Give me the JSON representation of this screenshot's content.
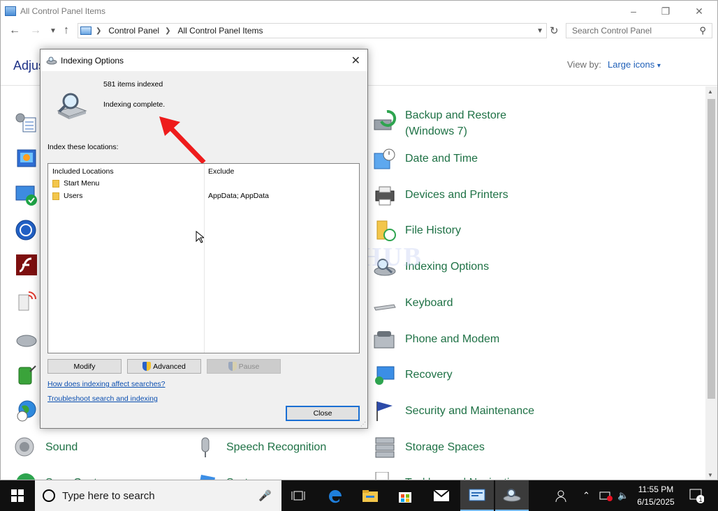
{
  "window": {
    "title": "All Control Panel Items",
    "breadcrumbs": [
      "Control Panel",
      "All Control Panel Items"
    ],
    "search_placeholder": "Search Control Panel",
    "heading": "Adjus",
    "view_by_label": "View by:",
    "view_by_value": "Large icons",
    "view_by_caret": "▾"
  },
  "left_items": [
    {
      "label": "",
      "icon": "admin-tools-icon"
    },
    {
      "label": "",
      "icon": "autoplay-icon"
    },
    {
      "label": "",
      "icon": "security-center-icon"
    },
    {
      "label": "",
      "icon": "ease-of-access-icon"
    },
    {
      "label": "",
      "icon": "flash-icon"
    },
    {
      "label": "",
      "icon": "internet-options-icon"
    },
    {
      "label": "",
      "icon": "mouse-icon"
    },
    {
      "label": "",
      "icon": "power-options-icon"
    },
    {
      "label": "",
      "icon": "region-icon"
    },
    {
      "label": "Sound",
      "icon": "speaker-icon"
    },
    {
      "label": "Sync Cent",
      "icon": "sync-center-icon"
    }
  ],
  "middle_items": [
    {
      "label": "Speech Recognition",
      "icon": "microphone-icon"
    },
    {
      "label": "System",
      "icon": "system-icon"
    }
  ],
  "right_items": [
    {
      "label": "Backup and Restore (Windows 7)",
      "icon": "backup-restore-icon"
    },
    {
      "label": "Date and Time",
      "icon": "date-time-icon"
    },
    {
      "label": "Devices and Printers",
      "icon": "devices-printers-icon"
    },
    {
      "label": "File History",
      "icon": "file-history-icon"
    },
    {
      "label": "Indexing Options",
      "icon": "indexing-options-icon"
    },
    {
      "label": "Keyboard",
      "icon": "keyboard-icon"
    },
    {
      "label": "Phone and Modem",
      "icon": "phone-modem-icon"
    },
    {
      "label": "Recovery",
      "icon": "recovery-icon"
    },
    {
      "label": "Security and Maintenance",
      "icon": "security-maintenance-icon"
    },
    {
      "label": "Storage Spaces",
      "icon": "storage-spaces-icon"
    },
    {
      "label": "Taskbar and Navigation",
      "icon": "taskbar-navigation-icon"
    }
  ],
  "dialog": {
    "title": "Indexing Options",
    "items_indexed": "581 items indexed",
    "status": "Indexing complete.",
    "index_locations_label": "Index these locations:",
    "columns": {
      "included": "Included Locations",
      "exclude": "Exclude"
    },
    "locations": [
      {
        "name": "Start Menu",
        "exclude": ""
      },
      {
        "name": "Users",
        "exclude": "AppData; AppData"
      }
    ],
    "buttons": {
      "modify": "Modify",
      "advanced": "Advanced",
      "pause": "Pause",
      "close": "Close"
    },
    "links": {
      "how": "How does indexing affect searches?",
      "troubleshoot": "Troubleshoot search and indexing"
    }
  },
  "watermark": "IT Pros HUB",
  "taskbar": {
    "search_placeholder": "Type here to search",
    "time": "11:55 PM",
    "date": "6/15/2025",
    "notification_count": "1"
  },
  "colors": {
    "link": "#0b4fb0",
    "item_label": "#1e7145",
    "arrow": "#ee1c1c",
    "taskbar": "#101010"
  }
}
